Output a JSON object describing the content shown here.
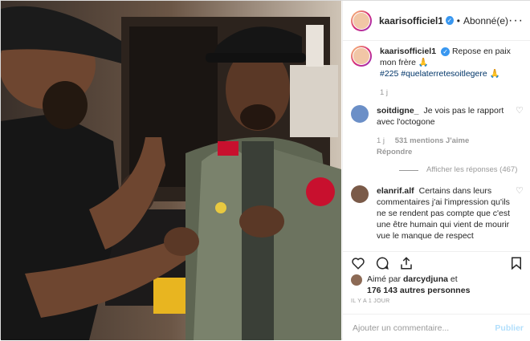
{
  "post": {
    "username": "kaarisofficiel1",
    "follow_status": "Abonné(e)",
    "separator": "•",
    "more": "···",
    "caption": "Repose en paix mon frère",
    "caption_emoji": "🙏",
    "hashtags": "#225 #quelaterretesoitlegere",
    "hashtag_emoji": "🙏",
    "caption_age": "1 j",
    "verified_mark": "✓"
  },
  "comments": [
    {
      "username": "soitdigne_",
      "text": "Je vois pas le rapport avec l'octogone",
      "age": "1 j",
      "likes": "531 mentions J'aime",
      "reply": "Répondre",
      "view_replies": "Afficher les réponses (467)",
      "avatar_color": "#6b8fc7"
    },
    {
      "username": "elanrif.alf",
      "text": "Certains dans leurs commentaires j'ai l'impression qu'ils ne se rendent pas compte que c'est une être humain qui vient de mourir vue le manque de respect",
      "avatar_color": "#7a5a48"
    }
  ],
  "likes": {
    "prefix": "Aimé par",
    "user": "darcydjuna",
    "joiner": "et",
    "count": "176 143 autres personnes"
  },
  "timestamp": "IL Y A 1 JOUR",
  "add_comment": {
    "placeholder": "Ajouter un commentaire...",
    "post_label": "Publier"
  },
  "colors": {
    "link": "#003569",
    "verified": "#3897f0",
    "publish": "#b2dffc",
    "muted": "#999999"
  },
  "icons": [
    "heart-icon",
    "comment-icon",
    "share-icon",
    "bookmark-icon",
    "verified-icon",
    "more-icon"
  ]
}
